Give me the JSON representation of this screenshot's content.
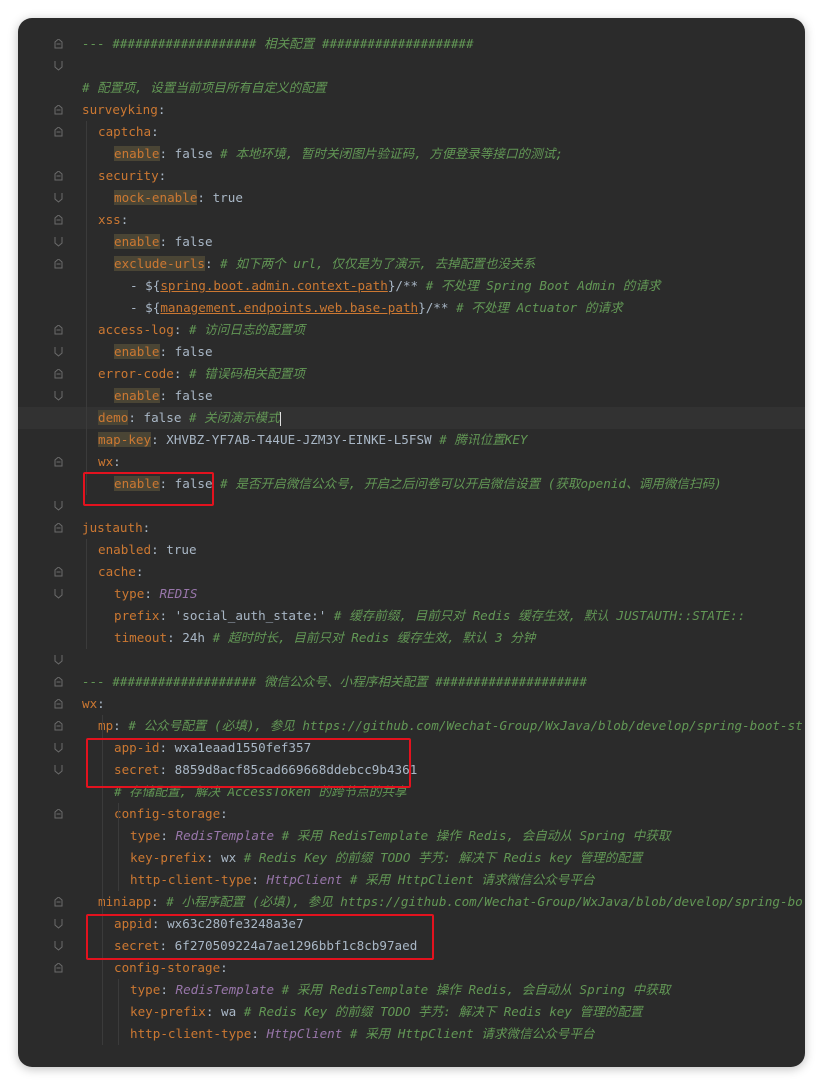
{
  "editor": {
    "lines": [
      {
        "t": "section",
        "text": "--- ################### 相关配置 ####################"
      },
      {
        "t": "blank"
      },
      {
        "t": "comment",
        "text": "# 配置项, 设置当前项目所有自定义的配置"
      },
      {
        "t": "key",
        "ind": 0,
        "key": "surveyking",
        "sep": ":"
      },
      {
        "t": "key",
        "ind": 1,
        "key": "captcha",
        "sep": ":"
      },
      {
        "t": "kv",
        "ind": 2,
        "key": "enable",
        "hl": true,
        "value": "false",
        "comment": "# 本地环境, 暂时关闭图片验证码, 方便登录等接口的测试;"
      },
      {
        "t": "key",
        "ind": 1,
        "key": "security",
        "sep": ":"
      },
      {
        "t": "kv",
        "ind": 2,
        "key": "mock-enable",
        "hl": true,
        "value": "true"
      },
      {
        "t": "key",
        "ind": 1,
        "key": "xss",
        "sep": ":"
      },
      {
        "t": "kv",
        "ind": 2,
        "key": "enable",
        "hl": true,
        "value": "false"
      },
      {
        "t": "kc",
        "ind": 2,
        "key": "exclude-urls",
        "hl": true,
        "comment": "# 如下两个 url, 仅仅是为了演示, 去掉配置也没关系"
      },
      {
        "t": "item",
        "ind": 3,
        "pre": "- ${",
        "link": "spring.boot.admin.context-path",
        "post": "}/**",
        "comment": "# 不处理 Spring Boot Admin 的请求"
      },
      {
        "t": "item",
        "ind": 3,
        "pre": "- ${",
        "link": "management.endpoints.web.base-path",
        "post": "}/**",
        "comment": "# 不处理 Actuator 的请求"
      },
      {
        "t": "kc",
        "ind": 1,
        "key": "access-log",
        "comment": "# 访问日志的配置项"
      },
      {
        "t": "kv",
        "ind": 2,
        "key": "enable",
        "hl": true,
        "value": "false"
      },
      {
        "t": "kc",
        "ind": 1,
        "key": "error-code",
        "comment": "# 错误码相关配置项"
      },
      {
        "t": "kv",
        "ind": 2,
        "key": "enable",
        "hl": true,
        "value": "false"
      },
      {
        "t": "kv",
        "ind": 1,
        "key": "demo",
        "hl": true,
        "value": "false",
        "comment": "# 关闭演示模式",
        "cursor": true,
        "rowhl": true
      },
      {
        "t": "kv",
        "ind": 1,
        "key": "map-key",
        "hl": true,
        "value": "XHVBZ-YF7AB-T44UE-JZM3Y-EINKE-L5FSW",
        "comment": "# 腾讯位置KEY"
      },
      {
        "t": "key",
        "ind": 1,
        "key": "wx",
        "sep": ":"
      },
      {
        "t": "kv",
        "ind": 2,
        "key": "enable",
        "hl": true,
        "value": "false",
        "comment": "# 是否开启微信公众号, 开启之后问卷可以开启微信设置 (获取openid、调用微信扫码)"
      },
      {
        "t": "blank"
      },
      {
        "t": "key",
        "ind": 0,
        "key": "justauth",
        "sep": ":"
      },
      {
        "t": "kv",
        "ind": 1,
        "key": "enabled",
        "value": "true"
      },
      {
        "t": "key",
        "ind": 1,
        "key": "cache",
        "sep": ":"
      },
      {
        "t": "kv",
        "ind": 2,
        "key": "type",
        "value": "REDIS",
        "valueClass": "it"
      },
      {
        "t": "kv",
        "ind": 2,
        "key": "prefix",
        "value": "'social_auth_state:'",
        "valueClass": "v",
        "comment": "# 缓存前缀, 目前只对 Redis 缓存生效, 默认 JUSTAUTH::STATE::"
      },
      {
        "t": "kv",
        "ind": 2,
        "key": "timeout",
        "value": "24h",
        "comment": "# 超时时长, 目前只对 Redis 缓存生效, 默认 3 分钟"
      },
      {
        "t": "blank"
      },
      {
        "t": "section",
        "text": "--- ################### 微信公众号、小程序相关配置 ####################"
      },
      {
        "t": "key",
        "ind": 0,
        "key": "wx",
        "sep": ":"
      },
      {
        "t": "kc",
        "ind": 1,
        "key": "mp",
        "comment": "# 公众号配置 (必填), 参见 https://github.com/Wechat-Group/WxJava/blob/develop/spring-boot-st"
      },
      {
        "t": "kv",
        "ind": 2,
        "key": "app-id",
        "value": "wxa1eaad1550fef357"
      },
      {
        "t": "kv",
        "ind": 2,
        "key": "secret",
        "value": "8859d8acf85cad669668ddebcc9b4361"
      },
      {
        "t": "comment",
        "ind": 2,
        "text": "# 存储配置, 解决 AccessToken 的跨节点的共享"
      },
      {
        "t": "key",
        "ind": 2,
        "key": "config-storage",
        "sep": ":"
      },
      {
        "t": "kv",
        "ind": 3,
        "key": "type",
        "value": "RedisTemplate",
        "valueClass": "it",
        "comment": "# 采用 RedisTemplate 操作 Redis, 会自动从 Spring 中获取"
      },
      {
        "t": "kv",
        "ind": 3,
        "key": "key-prefix",
        "value": "wx",
        "comment": "# Redis Key 的前缀 TODO 芋艿: 解决下 Redis key 管理的配置"
      },
      {
        "t": "kv",
        "ind": 3,
        "key": "http-client-type",
        "value": "HttpClient",
        "valueClass": "it",
        "comment": "# 采用 HttpClient 请求微信公众号平台"
      },
      {
        "t": "kc",
        "ind": 1,
        "key": "miniapp",
        "comment": "# 小程序配置 (必填), 参见 https://github.com/Wechat-Group/WxJava/blob/develop/spring-bo"
      },
      {
        "t": "kv",
        "ind": 2,
        "key": "appid",
        "value": "wx63c280fe3248a3e7"
      },
      {
        "t": "kv",
        "ind": 2,
        "key": "secret",
        "value": "6f270509224a7ae1296bbf1c8cb97aed"
      },
      {
        "t": "key",
        "ind": 2,
        "key": "config-storage",
        "sep": ":"
      },
      {
        "t": "kv",
        "ind": 3,
        "key": "type",
        "value": "RedisTemplate",
        "valueClass": "it",
        "comment": "# 采用 RedisTemplate 操作 Redis, 会自动从 Spring 中获取"
      },
      {
        "t": "kv",
        "ind": 3,
        "key": "key-prefix",
        "value": "wa",
        "comment": "# Redis Key 的前缀 TODO 芋艿: 解决下 Redis key 管理的配置"
      },
      {
        "t": "kv",
        "ind": 3,
        "key": "http-client-type",
        "value": "HttpClient",
        "valueClass": "it",
        "comment": "# 采用 HttpClient 请求微信公众号平台"
      }
    ]
  },
  "annotations": {
    "boxes_color": "#e3121e"
  }
}
